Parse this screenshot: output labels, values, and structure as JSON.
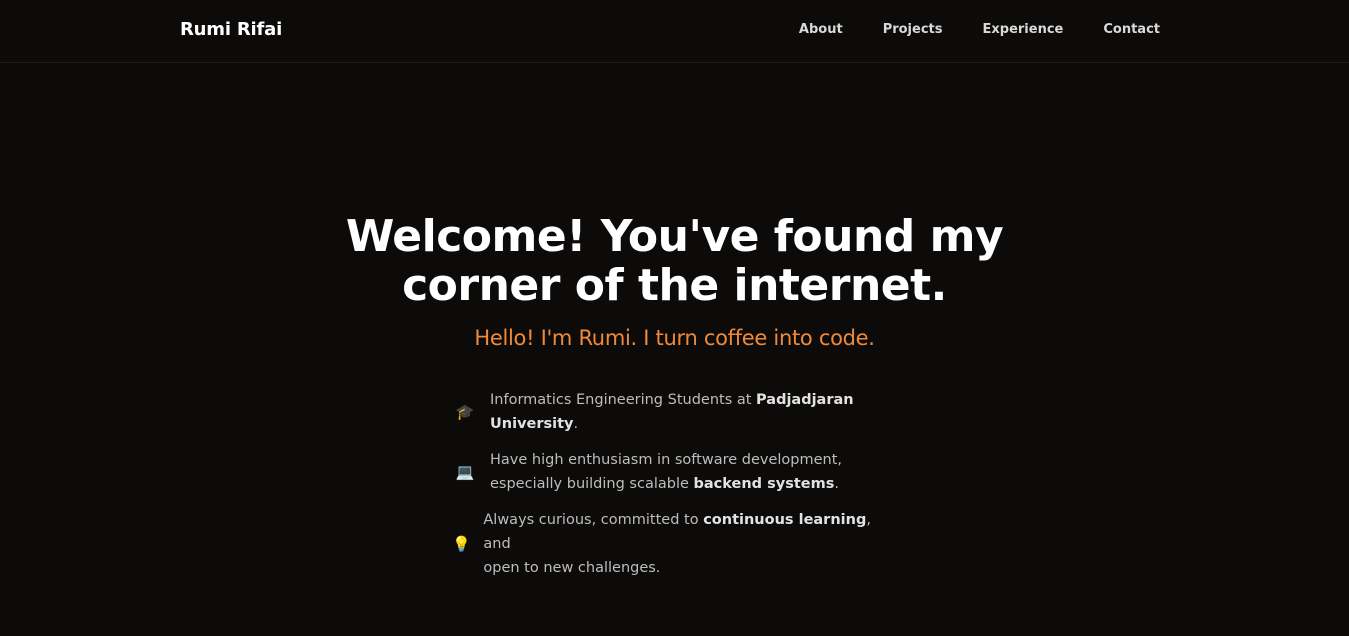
{
  "nav": {
    "brand": "Rumi Rifai",
    "links": [
      "About",
      "Projects",
      "Experience",
      "Contact"
    ]
  },
  "hero": {
    "title_line1": "Welcome! You've found my",
    "title_line2": "corner of the internet.",
    "subtitle": "Hello! I'm Rumi. I turn coffee into code."
  },
  "bullets": [
    {
      "icon": "graduation-cap-icon",
      "glyph": "🎓",
      "line1_a": "Informatics Engineering Students at ",
      "line1_bold": "Padjadjaran",
      "line2_bold": "University",
      "line2_b": "."
    },
    {
      "icon": "laptop-icon",
      "glyph": "💻",
      "line1_a": "Have high enthusiasm in software development,",
      "line2_a": "especially building scalable ",
      "line2_bold": "backend systems",
      "line2_b": "."
    },
    {
      "icon": "lightbulb-icon",
      "glyph": "💡",
      "line1_a": "Always curious, committed to ",
      "line1_bold": "continuous learning",
      "line1_b": ", and",
      "line2_a": "open to new challenges."
    }
  ],
  "colors": {
    "background": "#0c0b0a",
    "accent": "#f08a3a",
    "text": "#ffffff",
    "muted": "#bdbdbd"
  }
}
